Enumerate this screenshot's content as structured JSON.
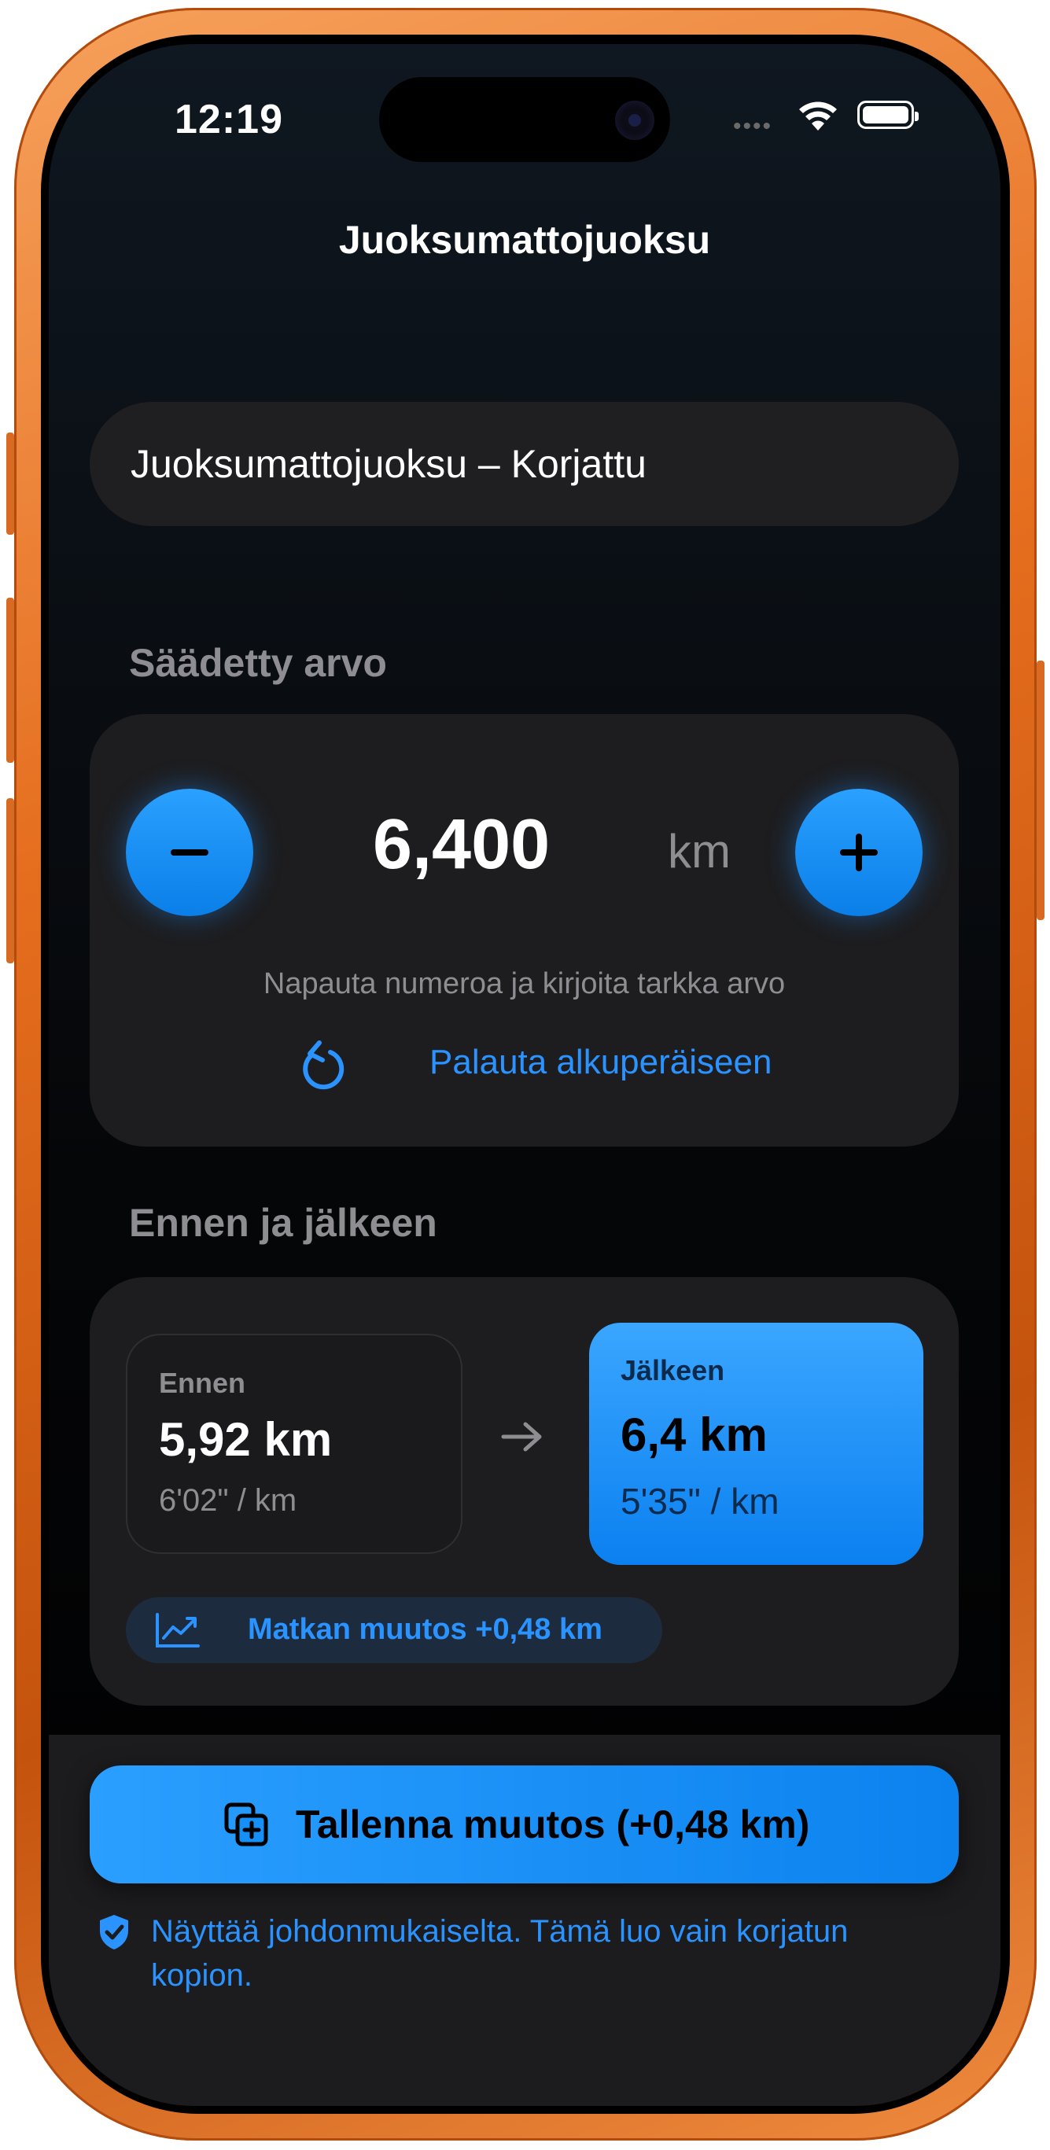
{
  "status_bar": {
    "time": "12:19",
    "signal": "••••"
  },
  "nav": {
    "title": "Juoksumattojuoksu"
  },
  "name_field": {
    "value": "Juoksumattojuoksu – Korjattu"
  },
  "adjusted": {
    "section_label": "Säädetty arvo",
    "value": "6,400",
    "unit": "km",
    "hint": "Napauta numeroa ja kirjoita tarkka arvo",
    "reset_label": "Palauta alkuperäiseen"
  },
  "comparison": {
    "section_label": "Ennen ja jälkeen",
    "before": {
      "label": "Ennen",
      "value": "5,92 km",
      "pace": "6'02\" / km"
    },
    "after": {
      "label": "Jälkeen",
      "value": "6,4 km",
      "pace": "5'35\" / km"
    },
    "change_label": "Matkan muutos +0,48 km"
  },
  "save": {
    "button_label": "Tallenna muutos (+0,48 km)",
    "note": "Näyttää johdonmukaiselta. Tämä luo vain korjatun kopion."
  },
  "colors": {
    "accent": "#0a84ff",
    "frame": "#e56d1e",
    "card": "#1d1d1f"
  },
  "icons": {
    "minus": "minus-icon",
    "plus": "plus-icon",
    "reset": "arrow-counterclockwise-icon",
    "arrow": "arrow-right-icon",
    "chart": "trend-up-icon",
    "save": "copy-plus-icon",
    "shield": "checkmark-shield-icon"
  }
}
